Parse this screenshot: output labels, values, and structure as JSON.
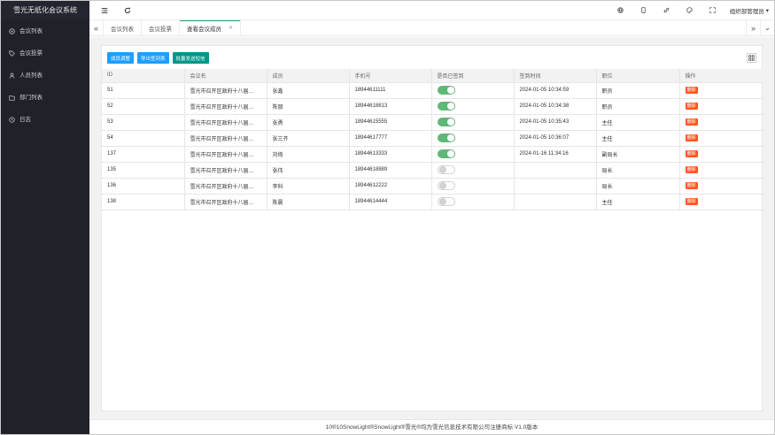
{
  "sidebar": {
    "brand": "雪光无纸化会议系统",
    "items": [
      {
        "label": "会议列表",
        "icon": "monitor-icon"
      },
      {
        "label": "会议投票",
        "icon": "tag-icon"
      },
      {
        "label": "人员列表",
        "icon": "user-icon"
      },
      {
        "label": "部门列表",
        "icon": "folder-icon"
      },
      {
        "label": "日志",
        "icon": "clock-icon"
      }
    ]
  },
  "header": {
    "user_label": "组织部管理员"
  },
  "tabs": [
    {
      "label": "会议列表",
      "active": false
    },
    {
      "label": "会议投票",
      "active": false
    },
    {
      "label": "查看会议成员",
      "active": true
    }
  ],
  "toolbar": {
    "adjust_label": "成员调整",
    "export_label": "导出签到表",
    "sms_label": "批量发送短信"
  },
  "table": {
    "columns": [
      "ID",
      "会议名",
      "成员",
      "手机号",
      "是否已签到",
      "签到时间",
      "职位",
      "操作"
    ],
    "delete_label": "删除",
    "rows": [
      {
        "id": "51",
        "meeting": "雪光市召开区政府十八届…",
        "member": "张鑫",
        "phone": "18944611111",
        "signed": true,
        "time": "2024-01-05 10:34:59",
        "position": "职员"
      },
      {
        "id": "52",
        "meeting": "雪光市召开区政府十八届…",
        "member": "陈朋",
        "phone": "18944618813",
        "signed": true,
        "time": "2024-01-05 10:34:38",
        "position": "职员"
      },
      {
        "id": "53",
        "meeting": "雪光市召开区政府十八届…",
        "member": "张勇",
        "phone": "18944615555",
        "signed": true,
        "time": "2024-01-05 10:35:43",
        "position": "主任"
      },
      {
        "id": "54",
        "meeting": "雪光市召开区政府十八届…",
        "member": "张三齐",
        "phone": "18944617777",
        "signed": true,
        "time": "2024-01-05 10:36:07",
        "position": "主任"
      },
      {
        "id": "137",
        "meeting": "雪光市召开区政府十八届…",
        "member": "刘倚",
        "phone": "18944613333",
        "signed": true,
        "time": "2024-01-16 11:34:16",
        "position": "副局长"
      },
      {
        "id": "135",
        "meeting": "雪光市召开区政府十八届…",
        "member": "张伟",
        "phone": "18944618889",
        "signed": false,
        "time": "",
        "position": "局长"
      },
      {
        "id": "136",
        "meeting": "雪光市召开区政府十八届…",
        "member": "李科",
        "phone": "18944612222",
        "signed": false,
        "time": "",
        "position": "局长"
      },
      {
        "id": "138",
        "meeting": "雪光市召开区政府十八届…",
        "member": "陈晨",
        "phone": "18944614444",
        "signed": false,
        "time": "",
        "position": "主任"
      }
    ]
  },
  "footer": {
    "text": "10®10SnowLight®SnowLight®雪光®均为雪光信息技术有限公司注册商标 V1.0版本"
  },
  "colors": {
    "sidebar_bg": "#20222a",
    "switch_on": "#5fb878",
    "button_blue": "#1e9fff",
    "button_green": "#009688",
    "delete_red": "#ff5722"
  }
}
